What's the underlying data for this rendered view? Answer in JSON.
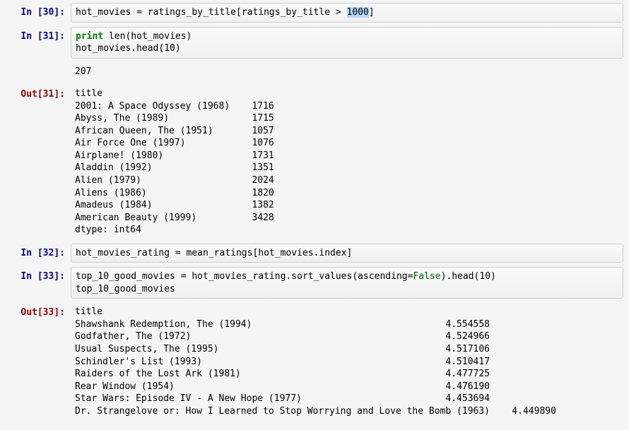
{
  "cells": [
    {
      "prompt_in": "In [30]:",
      "code_html": "hot_movies = ratings_by_title[ratings_by_title &gt; <span class=\"sel\">1000</span>]"
    },
    {
      "prompt_in": "In [31]:",
      "code_html": "<span class=\"kw\">print</span> len(hot_movies)\nhot_movies.head(10)"
    },
    {
      "prompt_out": "",
      "text": "207"
    },
    {
      "prompt_out": "Out[31]:",
      "text": "title\n2001: A Space Odyssey (1968)    1716\nAbyss, The (1989)               1715\nAfrican Queen, The (1951)       1057\nAir Force One (1997)            1076\nAirplane! (1980)                1731\nAladdin (1992)                  1351\nAlien (1979)                    2024\nAliens (1986)                   1820\nAmadeus (1984)                  1382\nAmerican Beauty (1999)          3428\ndtype: int64"
    },
    {
      "prompt_in": "In [32]:",
      "code_html": "hot_movies_rating = mean_ratings[hot_movies.index]"
    },
    {
      "prompt_in": "In [33]:",
      "code_html": "top_10_good_movies = hot_movies_rating.sort_values(ascending=<span class=\"val\">False</span>).head(10)\ntop_10_good_movies"
    },
    {
      "prompt_out": "Out[33]:",
      "text": "title\nShawshank Redemption, The (1994)                                   4.554558\nGodfather, The (1972)                                              4.524966\nUsual Suspects, The (1995)                                         4.517106\nSchindler's List (1993)                                            4.510417\nRaiders of the Lost Ark (1981)                                     4.477725\nRear Window (1954)                                                 4.476190\nStar Wars: Episode IV - A New Hope (1977)                          4.453694\nDr. Strangelove or: How I Learned to Stop Worrying and Love the Bomb (1963)    4.449890"
    }
  ],
  "chart_data": [
    {
      "type": "table",
      "title": "hot_movies.head(10)",
      "index_name": "title",
      "rows": [
        {
          "title": "2001: A Space Odyssey (1968)",
          "count": 1716
        },
        {
          "title": "Abyss, The (1989)",
          "count": 1715
        },
        {
          "title": "African Queen, The (1951)",
          "count": 1057
        },
        {
          "title": "Air Force One (1997)",
          "count": 1076
        },
        {
          "title": "Airplane! (1980)",
          "count": 1731
        },
        {
          "title": "Aladdin (1992)",
          "count": 1351
        },
        {
          "title": "Alien (1979)",
          "count": 2024
        },
        {
          "title": "Aliens (1986)",
          "count": 1820
        },
        {
          "title": "Amadeus (1984)",
          "count": 1382
        },
        {
          "title": "American Beauty (1999)",
          "count": 3428
        }
      ],
      "dtype": "int64",
      "len_hot_movies": 207
    },
    {
      "type": "table",
      "title": "top_10_good_movies",
      "index_name": "title",
      "rows": [
        {
          "title": "Shawshank Redemption, The (1994)",
          "rating": 4.554558
        },
        {
          "title": "Godfather, The (1972)",
          "rating": 4.524966
        },
        {
          "title": "Usual Suspects, The (1995)",
          "rating": 4.517106
        },
        {
          "title": "Schindler's List (1993)",
          "rating": 4.510417
        },
        {
          "title": "Raiders of the Lost Ark (1981)",
          "rating": 4.477725
        },
        {
          "title": "Rear Window (1954)",
          "rating": 4.47619
        },
        {
          "title": "Star Wars: Episode IV - A New Hope (1977)",
          "rating": 4.453694
        },
        {
          "title": "Dr. Strangelove or: How I Learned to Stop Worrying and Love the Bomb (1963)",
          "rating": 4.44989
        }
      ]
    }
  ]
}
